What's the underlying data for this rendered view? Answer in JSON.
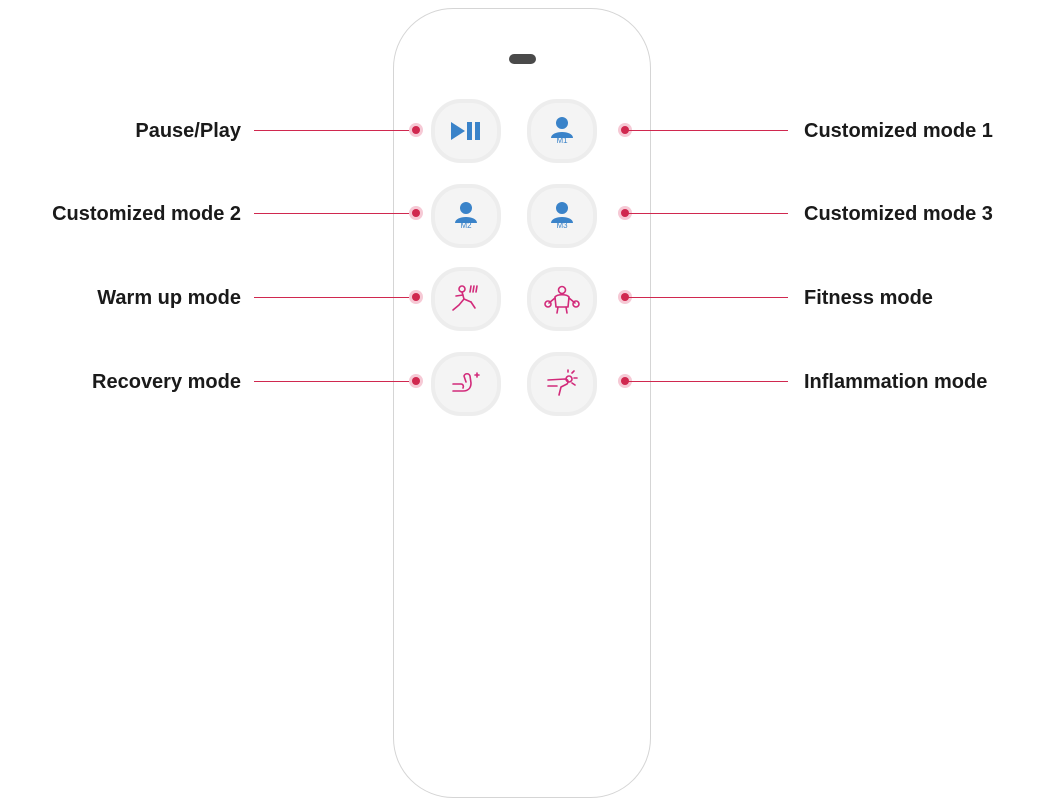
{
  "labels": {
    "pause_play": "Pause/Play",
    "custom_mode_1": "Customized mode 1",
    "custom_mode_2": "Customized mode 2",
    "custom_mode_3": "Customized mode 3",
    "warm_up": "Warm up mode",
    "fitness": "Fitness mode",
    "recovery": "Recovery mode",
    "inflammation": "Inflammation mode"
  },
  "buttons": {
    "m1": "M1",
    "m2": "M2",
    "m3": "M3"
  },
  "icons": {
    "pause_play": "play-pause-icon",
    "user": "user-icon",
    "warm_up": "stretching-person-icon",
    "fitness": "weightlifting-icon",
    "recovery": "flexed-arm-icon",
    "inflammation": "sore-arm-icon"
  },
  "colors": {
    "callout": "#d0284f",
    "icon_blue": "#3a83c9",
    "icon_pink": "#d22a7a"
  }
}
